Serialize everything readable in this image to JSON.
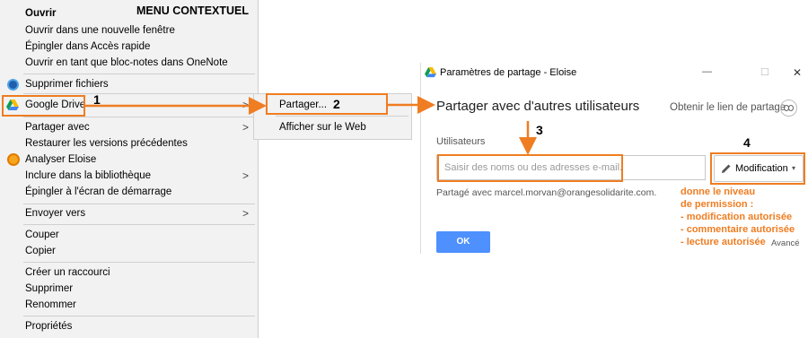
{
  "title": "MENU CONTEXTUEL",
  "context_menu": {
    "items": [
      {
        "label": "Ouvrir"
      },
      {
        "label": "Ouvrir dans une nouvelle fenêtre"
      },
      {
        "label": "Épingler dans Accès rapide"
      },
      {
        "label": "Ouvrir en tant que bloc-notes dans OneNote"
      },
      {
        "label": "Supprimer fichiers"
      },
      {
        "label": "Google Drive"
      },
      {
        "label": "Partager avec"
      },
      {
        "label": "Restaurer les versions précédentes"
      },
      {
        "label": "Analyser Eloise"
      },
      {
        "label": "Inclure dans la bibliothèque"
      },
      {
        "label": "Épingler à l'écran de démarrage"
      },
      {
        "label": "Envoyer vers"
      },
      {
        "label": "Couper"
      },
      {
        "label": "Copier"
      },
      {
        "label": "Créer un raccourci"
      },
      {
        "label": "Supprimer"
      },
      {
        "label": "Renommer"
      },
      {
        "label": "Propriétés"
      }
    ],
    "arrow_glyph": ">"
  },
  "submenu": {
    "items": [
      {
        "label": "Partager..."
      },
      {
        "label": "Afficher sur le Web"
      }
    ]
  },
  "dialog": {
    "window_title": "Paramètres de partage - Eloise",
    "minimize_glyph": "—",
    "maximize_glyph": "☐",
    "close_glyph": "✕",
    "heading": "Partager avec d'autres utilisateurs",
    "get_link_label": "Obtenir le lien de partage",
    "users_label": "Utilisateurs",
    "users_input_placeholder": "Saisir des noms ou des adresses e-mail.",
    "permission_button_label": "Modification",
    "shared_with_text": "Partagé avec marcel.morvan@orangesolidarite.com.",
    "ok_label": "OK",
    "advanced_label": "Avancé"
  },
  "annotations": {
    "step_numbers": [
      "1",
      "2",
      "3",
      "4"
    ],
    "note_lines": [
      "donne le niveau",
      "de permission :",
      "- modification autorisée",
      "- commentaire autorisée",
      "- lecture autorisée"
    ]
  },
  "colors": {
    "annotation_orange": "#ef7d22",
    "ok_button_blue": "#4d90fe",
    "menu_background": "#f2f2f2"
  }
}
